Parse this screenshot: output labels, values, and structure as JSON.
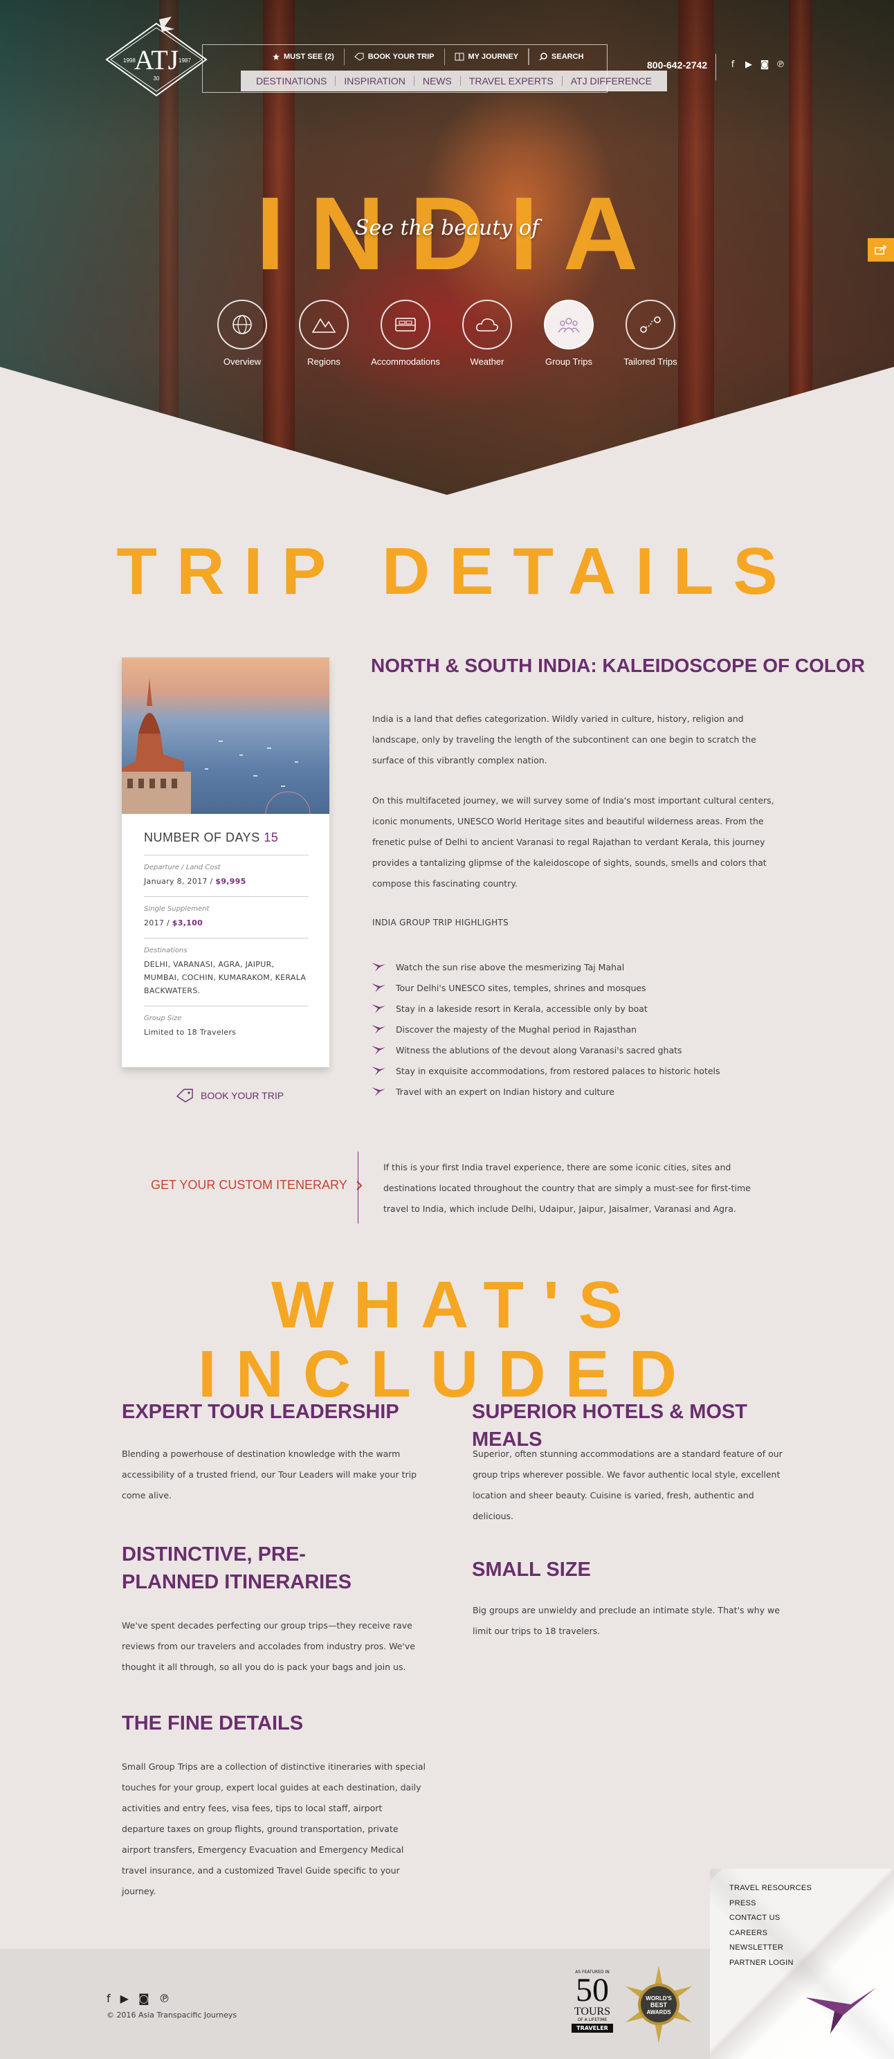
{
  "header": {
    "logo": {
      "letters": "ATJ",
      "est": "1987",
      "since": "1998",
      "years": "30"
    },
    "top_nav": [
      {
        "label": "MUST SEE (2)",
        "icon": "star-icon"
      },
      {
        "label": "BOOK YOUR TRIP",
        "icon": "tag-icon"
      },
      {
        "label": "MY JOURNEY",
        "icon": "book-icon"
      }
    ],
    "search_label": "SEARCH",
    "main_nav": [
      "DESTINATIONS",
      "INSPIRATION",
      "NEWS",
      "TRAVEL EXPERTS",
      "ATJ DIFFERENCE"
    ],
    "phone": "800-642-2742",
    "social": [
      "facebook-icon",
      "youtube-icon",
      "instagram-icon",
      "pinterest-icon"
    ]
  },
  "hero": {
    "title": "INDIA",
    "tagline": "See the beauty of",
    "sections": [
      {
        "label": "Overview",
        "icon": "globe-icon",
        "active": false
      },
      {
        "label": "Regions",
        "icon": "mountains-icon",
        "active": false
      },
      {
        "label": "Accommodations",
        "icon": "bed-icon",
        "active": false
      },
      {
        "label": "Weather",
        "icon": "cloud-icon",
        "active": false
      },
      {
        "label": "Group Trips",
        "icon": "group-icon",
        "active": true
      },
      {
        "label": "Tailored Trips",
        "icon": "route-icon",
        "active": false
      }
    ]
  },
  "trip_details": {
    "heading": "TRIP DETAILS",
    "card": {
      "days_label": "NUMBER OF DAYS",
      "days_value": "15",
      "departure_label": "Departure / Land Cost",
      "departure_date": "January 8, 2017 / ",
      "departure_price": "$9,995",
      "supplement_label": "Single Supplement",
      "supplement_year": "2017 / ",
      "supplement_price": "$3,100",
      "destinations_label": "Destinations",
      "destinations": "DELHI, VARANASI, AGRA, JAIPUR, MUMBAI, COCHIN, KUMARAKOM, KERALA BACKWATERS.",
      "group_label": "Group Size",
      "group_value": "Limited to 18 Travelers"
    },
    "book_label": "BOOK YOUR TRIP",
    "title": "NORTH & SOUTH INDIA: KALEIDOSCOPE OF COLOR",
    "paragraph_1": "India is a land that defies categorization. Wildly varied in culture, history, religion and landscape, only by traveling the length of the subcontinent can one begin to scratch the surface of this vibrantly complex nation.",
    "paragraph_2": "On this multifaceted journey, we will survey some of India's most important cultural centers, iconic monuments, UNESCO World Heritage sites and beautiful wilderness areas. From the frenetic pulse of Delhi to ancient Varanasi to regal Rajathan to verdant Kerala, this journey provides a tantalizing glipmse of the kaleidoscope of sights, sounds, smells and colors that compose this fascinating country.",
    "highlights_label": "INDIA GROUP TRIP HIGHLIGHTS",
    "highlights": [
      "Watch the sun rise above the mesmerizing Taj Mahal",
      "Tour Delhi's UNESCO sites, temples, shrines and mosques",
      "Stay in a lakeside resort in Kerala, accessible only by boat",
      "Discover the majesty of the Mughal period in Rajasthan",
      "Witness the ablutions of the devout along Varanasi's sacred ghats",
      "Stay in exquisite accommodations, from restored palaces to historic hotels",
      "Travel with an expert on Indian history and culture"
    ],
    "custom_label": "GET YOUR CUSTOM ITENERARY",
    "custom_text": "If this is your first India travel experience, there are some iconic cities, sites and destinations located throughout the country that are simply a must-see for first-time travel to India, which include Delhi, Udaipur, Jaipur, Jaisalmer, Varanasi and Agra."
  },
  "included": {
    "heading": "WHAT'S INCLUDED",
    "items": [
      {
        "title": "EXPERT TOUR LEADERSHIP",
        "text": "Blending a powerhouse of destination knowledge with the warm accessibility of a trusted friend, our Tour Leaders will make your trip come alive."
      },
      {
        "title": "SUPERIOR HOTELS & MOST MEALS",
        "text": "Superior, often stunning accommodations are a standard feature of our group trips wherever possible. We favor authentic local style, excellent location and sheer beauty. Cuisine is varied, fresh, authentic and delicious."
      },
      {
        "title": "DISTINCTIVE, PRE-PLANNED ITINERARIES",
        "text": "We've spent decades perfecting our group trips—they receive rave reviews from our travelers and accolades from industry pros. We've thought it all through, so all you do is pack your bags and join us."
      },
      {
        "title": "SMALL SIZE",
        "text": "Big groups are unwieldy and preclude an intimate style. That's why we limit our trips to 18 travelers."
      },
      {
        "title": "THE FINE DETAILS",
        "text": "Small Group Trips are a collection of distinctive itineraries with special touches for your group, expert local guides at each destination, daily activities and entry fees, visa fees, tips to local staff, airport departure taxes on group flights, ground transportation, private airport transfers, Emergency Evacuation and Emergency Medical travel insurance, and a customized Travel Guide specific to your journey."
      }
    ]
  },
  "footer": {
    "copyright": "© 2016 Asia Transpacific Journeys",
    "badge": {
      "featured": "AS FEATURED IN",
      "number": "50",
      "tours": "TOURS",
      "sub": "OF A LIFETIME",
      "publication": "TRAVELER"
    },
    "award": {
      "line1": "WORLD'S",
      "line2": "BEST",
      "line3": "AWARDS"
    },
    "links": [
      "TRAVEL RESOURCES",
      "PRESS",
      "CONTACT US",
      "CAREERS",
      "NEWSLETTER",
      "PARTNER LOGIN"
    ],
    "colors": {
      "accent": "#f5a623",
      "brand_purple": "#6a2d6e",
      "link_red": "#c9402e"
    }
  }
}
